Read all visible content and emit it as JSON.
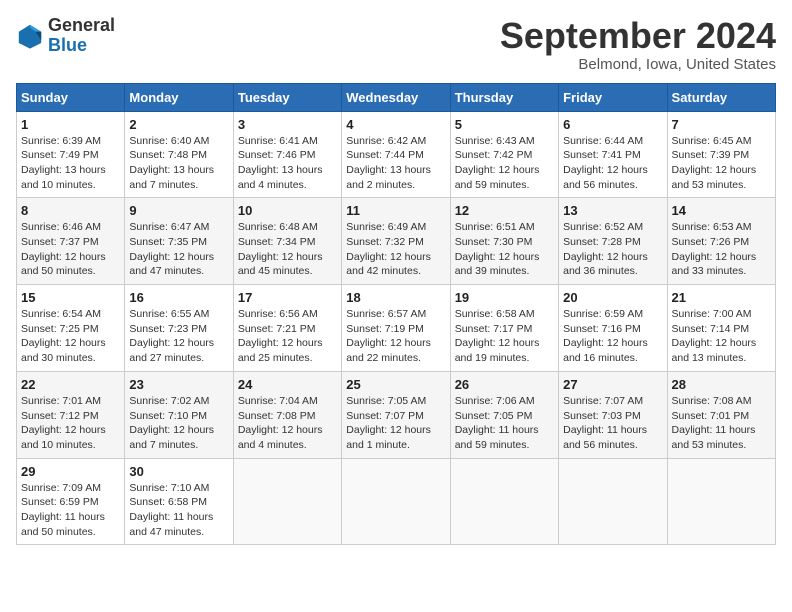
{
  "header": {
    "logo_general": "General",
    "logo_blue": "Blue",
    "month_title": "September 2024",
    "location": "Belmond, Iowa, United States"
  },
  "weekdays": [
    "Sunday",
    "Monday",
    "Tuesday",
    "Wednesday",
    "Thursday",
    "Friday",
    "Saturday"
  ],
  "weeks": [
    [
      {
        "day": "1",
        "sunrise": "6:39 AM",
        "sunset": "7:49 PM",
        "daylight": "13 hours and 10 minutes."
      },
      {
        "day": "2",
        "sunrise": "6:40 AM",
        "sunset": "7:48 PM",
        "daylight": "13 hours and 7 minutes."
      },
      {
        "day": "3",
        "sunrise": "6:41 AM",
        "sunset": "7:46 PM",
        "daylight": "13 hours and 4 minutes."
      },
      {
        "day": "4",
        "sunrise": "6:42 AM",
        "sunset": "7:44 PM",
        "daylight": "13 hours and 2 minutes."
      },
      {
        "day": "5",
        "sunrise": "6:43 AM",
        "sunset": "7:42 PM",
        "daylight": "12 hours and 59 minutes."
      },
      {
        "day": "6",
        "sunrise": "6:44 AM",
        "sunset": "7:41 PM",
        "daylight": "12 hours and 56 minutes."
      },
      {
        "day": "7",
        "sunrise": "6:45 AM",
        "sunset": "7:39 PM",
        "daylight": "12 hours and 53 minutes."
      }
    ],
    [
      {
        "day": "8",
        "sunrise": "6:46 AM",
        "sunset": "7:37 PM",
        "daylight": "12 hours and 50 minutes."
      },
      {
        "day": "9",
        "sunrise": "6:47 AM",
        "sunset": "7:35 PM",
        "daylight": "12 hours and 47 minutes."
      },
      {
        "day": "10",
        "sunrise": "6:48 AM",
        "sunset": "7:34 PM",
        "daylight": "12 hours and 45 minutes."
      },
      {
        "day": "11",
        "sunrise": "6:49 AM",
        "sunset": "7:32 PM",
        "daylight": "12 hours and 42 minutes."
      },
      {
        "day": "12",
        "sunrise": "6:51 AM",
        "sunset": "7:30 PM",
        "daylight": "12 hours and 39 minutes."
      },
      {
        "day": "13",
        "sunrise": "6:52 AM",
        "sunset": "7:28 PM",
        "daylight": "12 hours and 36 minutes."
      },
      {
        "day": "14",
        "sunrise": "6:53 AM",
        "sunset": "7:26 PM",
        "daylight": "12 hours and 33 minutes."
      }
    ],
    [
      {
        "day": "15",
        "sunrise": "6:54 AM",
        "sunset": "7:25 PM",
        "daylight": "12 hours and 30 minutes."
      },
      {
        "day": "16",
        "sunrise": "6:55 AM",
        "sunset": "7:23 PM",
        "daylight": "12 hours and 27 minutes."
      },
      {
        "day": "17",
        "sunrise": "6:56 AM",
        "sunset": "7:21 PM",
        "daylight": "12 hours and 25 minutes."
      },
      {
        "day": "18",
        "sunrise": "6:57 AM",
        "sunset": "7:19 PM",
        "daylight": "12 hours and 22 minutes."
      },
      {
        "day": "19",
        "sunrise": "6:58 AM",
        "sunset": "7:17 PM",
        "daylight": "12 hours and 19 minutes."
      },
      {
        "day": "20",
        "sunrise": "6:59 AM",
        "sunset": "7:16 PM",
        "daylight": "12 hours and 16 minutes."
      },
      {
        "day": "21",
        "sunrise": "7:00 AM",
        "sunset": "7:14 PM",
        "daylight": "12 hours and 13 minutes."
      }
    ],
    [
      {
        "day": "22",
        "sunrise": "7:01 AM",
        "sunset": "7:12 PM",
        "daylight": "12 hours and 10 minutes."
      },
      {
        "day": "23",
        "sunrise": "7:02 AM",
        "sunset": "7:10 PM",
        "daylight": "12 hours and 7 minutes."
      },
      {
        "day": "24",
        "sunrise": "7:04 AM",
        "sunset": "7:08 PM",
        "daylight": "12 hours and 4 minutes."
      },
      {
        "day": "25",
        "sunrise": "7:05 AM",
        "sunset": "7:07 PM",
        "daylight": "12 hours and 1 minute."
      },
      {
        "day": "26",
        "sunrise": "7:06 AM",
        "sunset": "7:05 PM",
        "daylight": "11 hours and 59 minutes."
      },
      {
        "day": "27",
        "sunrise": "7:07 AM",
        "sunset": "7:03 PM",
        "daylight": "11 hours and 56 minutes."
      },
      {
        "day": "28",
        "sunrise": "7:08 AM",
        "sunset": "7:01 PM",
        "daylight": "11 hours and 53 minutes."
      }
    ],
    [
      {
        "day": "29",
        "sunrise": "7:09 AM",
        "sunset": "6:59 PM",
        "daylight": "11 hours and 50 minutes."
      },
      {
        "day": "30",
        "sunrise": "7:10 AM",
        "sunset": "6:58 PM",
        "daylight": "11 hours and 47 minutes."
      },
      null,
      null,
      null,
      null,
      null
    ]
  ]
}
